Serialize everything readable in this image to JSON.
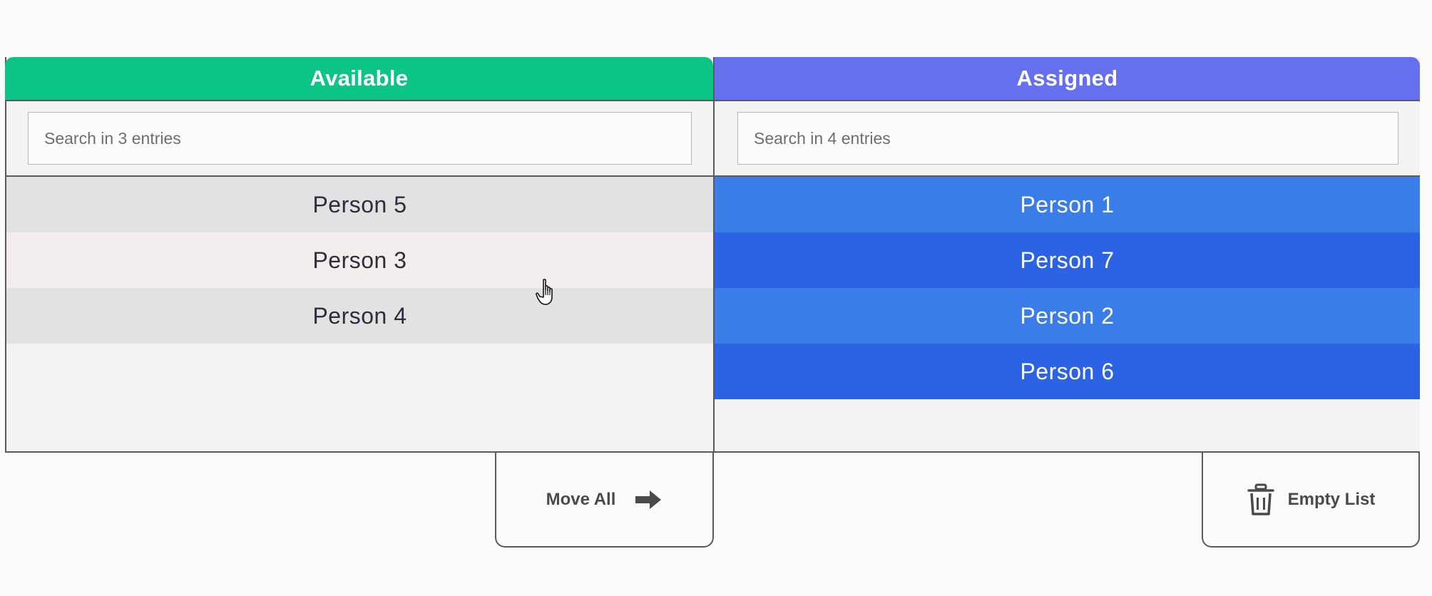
{
  "available": {
    "title": "Available",
    "search_placeholder": "Search in 3 entries",
    "items": [
      "Person 5",
      "Person 3",
      "Person 4"
    ]
  },
  "assigned": {
    "title": "Assigned",
    "search_placeholder": "Search in 4 entries",
    "items": [
      "Person 1",
      "Person 7",
      "Person 2",
      "Person 6"
    ]
  },
  "actions": {
    "move_all_label": "Move All",
    "move_all_icon": "arrow-right-icon",
    "empty_list_label": "Empty List",
    "empty_list_icon": "trash-icon"
  },
  "colors": {
    "available_header": "#0bc486",
    "assigned_header": "#6570ee",
    "assigned_row_light": "#3a7de8",
    "assigned_row_dark": "#2c62e4"
  }
}
